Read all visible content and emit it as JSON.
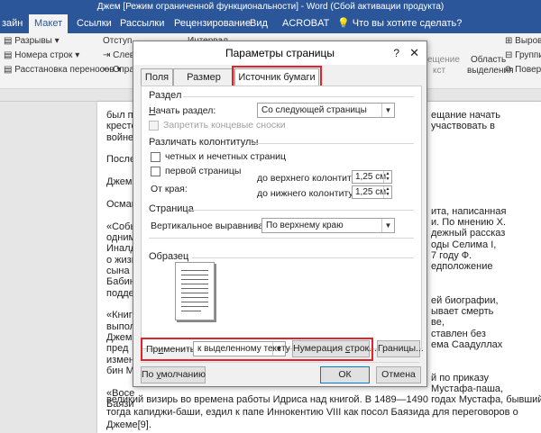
{
  "title": "Джем [Режим ограниченной функциональности] - Word (Сбой активации продукта)",
  "tabs": [
    {
      "label": "зайн",
      "active": false
    },
    {
      "label": "Макет",
      "active": true
    },
    {
      "label": "Ссылки",
      "active": false
    },
    {
      "label": "Рассылки",
      "active": false
    },
    {
      "label": "Рецензирование",
      "active": false
    },
    {
      "label": "Вид",
      "active": false
    },
    {
      "label": "ACROBAT",
      "active": false
    }
  ],
  "tell_me": "Что вы хотите сделать?",
  "ribbon": {
    "breaks": "Разрывы",
    "line_numbers": "Номера строк",
    "hyphenation": "Расстановка переносов",
    "indent": "Отступ",
    "spacing": "Интервал",
    "left": "Слев",
    "right": "Спра",
    "move": "ещение",
    "move_sub": "кст",
    "selection_pane": "Область",
    "selection_pane_sub": "выделения",
    "align": "Выровн",
    "group": "Группи",
    "rotate": "Поверн"
  },
  "document": {
    "left_lines": [
      "был пе",
      "крестс",
      "войне",
      "",
      "После",
      "",
      "Джем",
      "",
      "Осман",
      "",
      "«Собы",
      "одним",
      "Иналд",
      "о жизн",
      "сына Б",
      "Бабин",
      "подде",
      "",
      "«Книга",
      "выпол",
      "Джема",
      "пред",
      "измен",
      "бин М",
      "",
      "«Восе",
      "Баязи"
    ],
    "right_lines": [
      "ещание начать",
      "участвовать в",
      "ита, написанная",
      "и. По мнению Х.",
      "дежный рассказ",
      "оды Селима I,",
      "7 году Ф.",
      "едположение",
      "ей биографии,",
      "ывает смерть",
      "ве,",
      "ставлен без",
      "ема Саадуллах",
      "й по приказу",
      "Мустафа-паша,"
    ],
    "bottom_lines": [
      "великий визирь во времена работы Идриса над книгой. В 1489—1490 годах Мустафа, бывший",
      "тогда капиджи-баши, ездил к папе Иннокентию VIII как посол Баязида для переговоров о",
      "Джеме[9]."
    ]
  },
  "dialog": {
    "title": "Параметры страницы",
    "help": "?",
    "close": "✕",
    "tabs": [
      "Поля",
      "Размер бумаги",
      "Источник бумаги"
    ],
    "section_label": "Раздел",
    "section_start_label": "Начать раздел:",
    "section_start_value": "Со следующей страницы",
    "suppress_endnotes": "Запретить концевые сноски",
    "headers_label": "Различать колонтитулы",
    "odd_even": "четных и нечетных страниц",
    "first_page": "первой страницы",
    "from_edge": "От края:",
    "to_header": "до верхнего колонтитула:",
    "to_header_value": "1,25 см",
    "to_footer": "до нижнего колонтитула:",
    "to_footer_value": "1,25 см",
    "page_label": "Страница",
    "vert_align_label": "Вертикальное выравнивание:",
    "vert_align_value": "По верхнему краю",
    "sample_label": "Образец",
    "apply_label": "Применить:",
    "apply_value": "к выделенному тексту",
    "line_numbers_button": "Нумерация строк...",
    "borders_button": "Границы...",
    "default_button": "По умолчанию",
    "ok_button": "ОК",
    "cancel_button": "Отмена"
  },
  "colors": {
    "accent": "#2b579a",
    "highlight": "#e0242b"
  }
}
